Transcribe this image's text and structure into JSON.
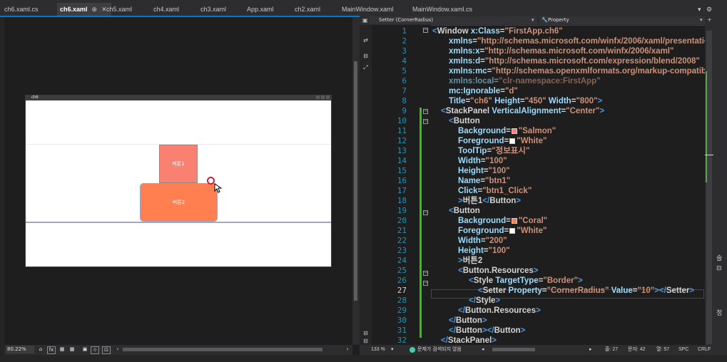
{
  "tabs": [
    {
      "label": "ch6.xaml.cs",
      "active": false
    },
    {
      "label": "ch6.xaml",
      "active": true,
      "pin": "⊕",
      "close": "✕"
    },
    {
      "label": "ch5.xaml",
      "active": false
    },
    {
      "label": "ch4.xaml",
      "active": false
    },
    {
      "label": "ch3.xaml",
      "active": false
    },
    {
      "label": "App.xaml",
      "active": false
    },
    {
      "label": "ch2.xaml",
      "active": false
    },
    {
      "label": "MainWindow.xaml",
      "active": false
    },
    {
      "label": "MainWindow.xaml.cs",
      "active": false
    }
  ],
  "tab_overflow": {
    "dropdown": "▾",
    "settings": "⚙"
  },
  "designer": {
    "window_title": "ch6",
    "button1_label": "버튼1",
    "button2_label": "버튼2",
    "button1_color": "#FA8072",
    "button2_color": "#FF7F50"
  },
  "designer_toolbar": {
    "zoom": "80.22%",
    "tools": [
      "⌂",
      "fx",
      "▦",
      "▦",
      "▣",
      "⊹",
      "⊡"
    ]
  },
  "navbar": {
    "element": "Setter (CornerRadius)",
    "property": "Property"
  },
  "line_numbers": [
    "1",
    "2",
    "3",
    "4",
    "5",
    "6",
    "7",
    "8",
    "9",
    "10",
    "11",
    "12",
    "13",
    "14",
    "15",
    "16",
    "17",
    "18",
    "19",
    "20",
    "21",
    "22",
    "23",
    "24",
    "25",
    "26",
    "27",
    "28",
    "29",
    "30",
    "31",
    "32"
  ],
  "current_line": "27",
  "code": {
    "l1": {
      "open": "<",
      "tag": "Window",
      "attr": " x:Class",
      "eq": "=",
      "val": "\"FirstApp.ch6\""
    },
    "l2": {
      "attr": "xmlns",
      "eq": "=",
      "val": "\"http://schemas.microsoft.com/winfx/2006/xaml/presentatio"
    },
    "l3": {
      "attr": "xmlns:x",
      "eq": "=",
      "val": "\"http://schemas.microsoft.com/winfx/2006/xaml\""
    },
    "l4": {
      "attr": "xmlns:d",
      "eq": "=",
      "val": "\"http://schemas.microsoft.com/expression/blend/2008\""
    },
    "l5": {
      "attr": "xmlns:mc",
      "eq": "=",
      "val": "\"http://schemas.openxmlformats.org/markup-compatibil"
    },
    "l6": {
      "attr": "xmlns:local",
      "eq": "=",
      "val": "\"clr-namespace:FirstApp\""
    },
    "l7": {
      "attr": "mc:Ignorable",
      "eq": "=",
      "val": "\"d\""
    },
    "l8": {
      "attr": "Title",
      "eq": "=",
      "val": "\"ch6\"",
      "attr2": " Height",
      "val2": "\"450\"",
      "attr3": " Width",
      "val3": "\"800\"",
      "close": ">"
    },
    "l9": {
      "open": "<",
      "tag": "StackPanel",
      "attr": " VerticalAlignment",
      "eq": "=",
      "val": "\"Center\"",
      "close": ">"
    },
    "l10": {
      "open": "<",
      "tag": "Button"
    },
    "l11": {
      "attr": "Background",
      "eq": "=",
      "val": "\"Salmon\"",
      "swatch": "#FA8072"
    },
    "l12": {
      "attr": "Foreground",
      "eq": "=",
      "val": "\"White\"",
      "swatch": "#FFFFFF"
    },
    "l13": {
      "attr": "ToolTip",
      "eq": "=",
      "val": "\"정보표시\""
    },
    "l14": {
      "attr": "Width",
      "eq": "=",
      "val": "\"100\""
    },
    "l15": {
      "attr": "Height",
      "eq": "=",
      "val": "\"100\""
    },
    "l16": {
      "attr": "Name",
      "eq": "=",
      "val": "\"btn1\""
    },
    "l17": {
      "attr": "Click",
      "eq": "=",
      "val": "\"btn1_Click\""
    },
    "l18": {
      "close": ">",
      "text": "버튼1",
      "endopen": "</",
      "tag": "Button",
      "endclose": ">"
    },
    "l19": {
      "open": "<",
      "tag": "Button"
    },
    "l20": {
      "attr": "Background",
      "eq": "=",
      "val": "\"Coral\"",
      "swatch": "#FF7F50"
    },
    "l21": {
      "attr": "Foreground",
      "eq": "=",
      "val": "\"White\"",
      "swatch": "#FFFFFF"
    },
    "l22": {
      "attr": "Width",
      "eq": "=",
      "val": "\"200\""
    },
    "l23": {
      "attr": "Height",
      "eq": "=",
      "val": "\"100\""
    },
    "l24": {
      "close": ">",
      "text": "버튼2"
    },
    "l25": {
      "open": "<",
      "tag": "Button.Resources",
      "close": ">"
    },
    "l26": {
      "open": "<",
      "tag": "Style",
      "attr": " TargetType",
      "eq": "=",
      "val": "\"Border\"",
      "close": ">"
    },
    "l27": {
      "open": "<",
      "tag": "Setter",
      "attr": " Property",
      "eq": "=",
      "val": "\"CornerRadius\"",
      "attr2": " Value",
      "val2": "\"10\"",
      "close": ">",
      "endopen": "</",
      "tag2": "Setter",
      "endclose": ">"
    },
    "l28": {
      "open": "</",
      "tag": "Style",
      "close": ">"
    },
    "l29": {
      "open": "</",
      "tag": "Button.Resources",
      "close": ">"
    },
    "l30": {
      "open": "</",
      "tag": "Button",
      "close": ">"
    },
    "l31": {
      "open": "</",
      "tag": "Button",
      "close": ">",
      "open2": "</",
      "tag2": "Button",
      "close2": ">"
    },
    "l32": {
      "open": "</",
      "tag": "StackPanel",
      "close": ">"
    }
  },
  "status": {
    "zoom": "133 %",
    "issues": "문제가 검색되지 않음",
    "line": "줄: 27",
    "col": "문자: 42",
    "pos": "열: 57",
    "spc": "SPC",
    "eol": "CRLF"
  },
  "colors": {
    "accent": "#007ACC",
    "tag": "#569CD6",
    "attribute": "#9CDCFE",
    "value": "#CE9178",
    "change_bar": "#57A64A"
  }
}
